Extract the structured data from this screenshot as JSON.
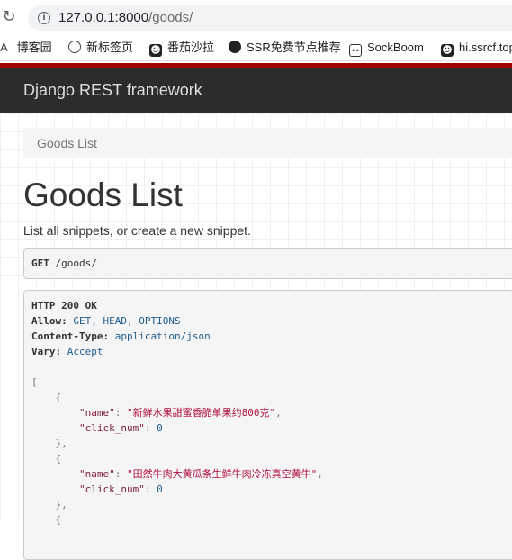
{
  "browser": {
    "url_host": "127.0.0.1:8000",
    "url_path": "/goods/",
    "bookmarks": [
      {
        "label": "博客园",
        "icon": "blog-icon"
      },
      {
        "label": "新标签页",
        "icon": "globe-icon"
      },
      {
        "label": "番茄沙拉",
        "icon": "ghost-icon"
      },
      {
        "label": "SSR免费节点推荐",
        "icon": "globe-icon"
      },
      {
        "label": "SockBoom",
        "icon": "face-icon"
      },
      {
        "label": "hi.ssrcf.top",
        "icon": "ghost-icon"
      }
    ]
  },
  "navbar": {
    "brand": "Django REST framework"
  },
  "breadcrumb": {
    "item": "Goods List"
  },
  "page": {
    "title": "Goods List",
    "description": "List all snippets, or create a new snippet."
  },
  "request": {
    "method": "GET",
    "path": "/goods/"
  },
  "response": {
    "status": "HTTP 200 OK",
    "headers": [
      {
        "name": "Allow",
        "value": "GET, HEAD, OPTIONS"
      },
      {
        "name": "Content-Type",
        "value": "application/json"
      },
      {
        "name": "Vary",
        "value": "Accept"
      }
    ],
    "items": [
      {
        "name": "新鲜水果甜蜜香脆单果约800克",
        "click_num": "0"
      },
      {
        "name": "田然牛肉大黄瓜条生鲜牛肉冷冻真空黄牛",
        "click_num": "0"
      }
    ],
    "key_name": "\"name\"",
    "key_click": "\"click_num\""
  },
  "colors": {
    "navbar": "#2c2c2c",
    "accent_stripe": "#a30000"
  }
}
